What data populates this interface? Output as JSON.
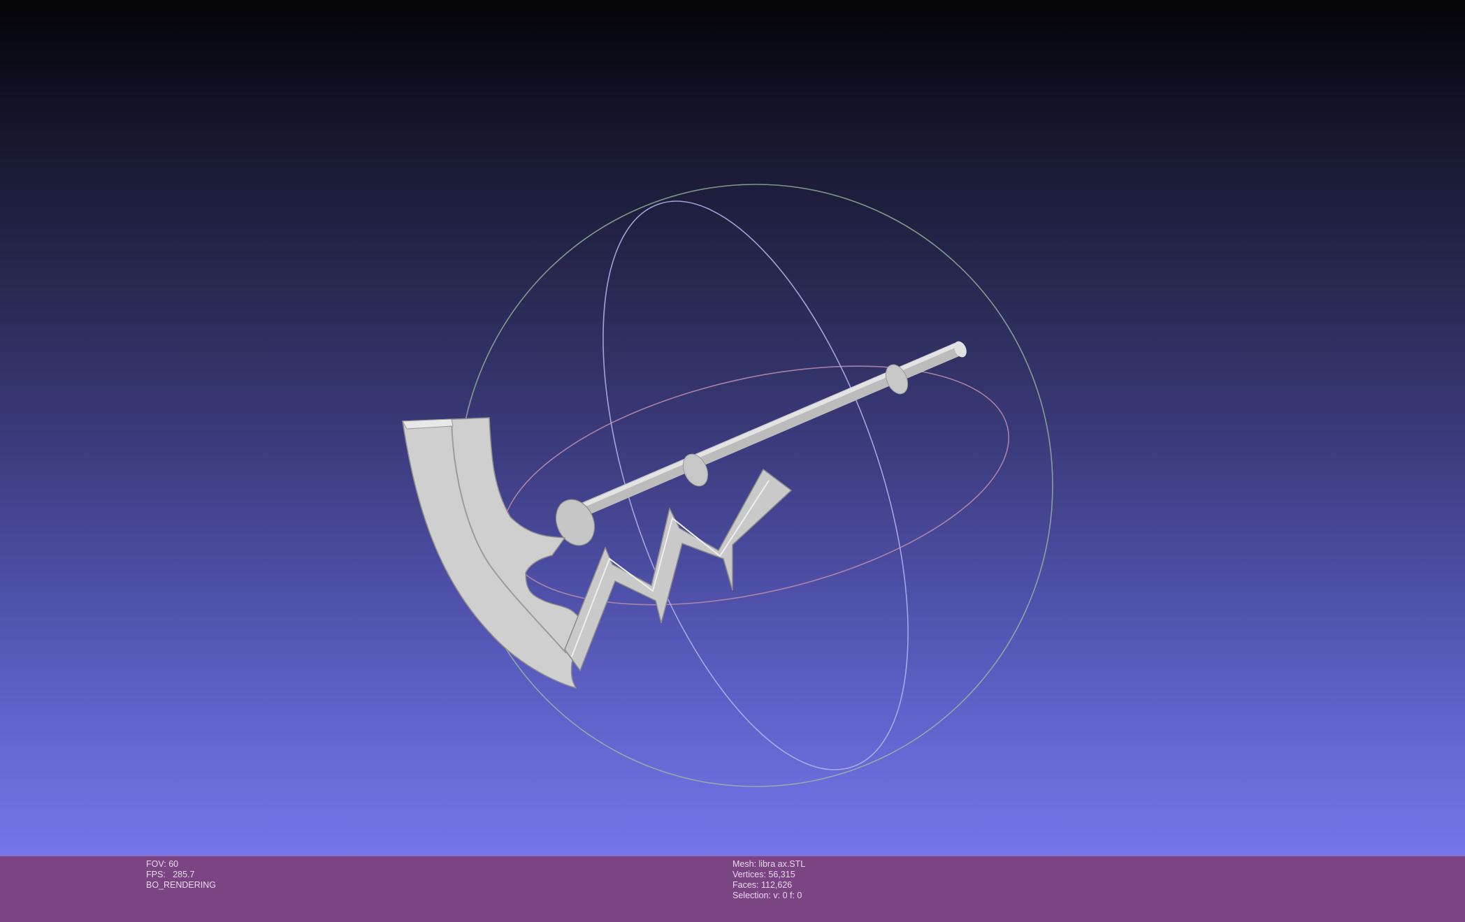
{
  "viewer": {
    "stats_left": {
      "fov_label": "FOV:",
      "fov_value": "60",
      "fps_label": "FPS:",
      "fps_value": "285.7",
      "render_mode": "BO_RENDERING"
    },
    "stats_right": {
      "mesh_label": "Mesh:",
      "mesh_name": "libra ax.STL",
      "vertices_label": "Vertices:",
      "vertices_value": "56,315",
      "faces_label": "Faces:",
      "faces_value": "112,626",
      "selection_label": "Selection:",
      "selection_value": "v: 0 f: 0"
    }
  },
  "colors": {
    "background_top": "#030307",
    "background_bottom": "#7476e9",
    "info_bar": "#7b4583",
    "mesh": "#d4d4d4",
    "trackball_x": "#c7a1c8",
    "trackball_y": "#a9c9a4",
    "trackball_z": "#c2c2ea"
  }
}
